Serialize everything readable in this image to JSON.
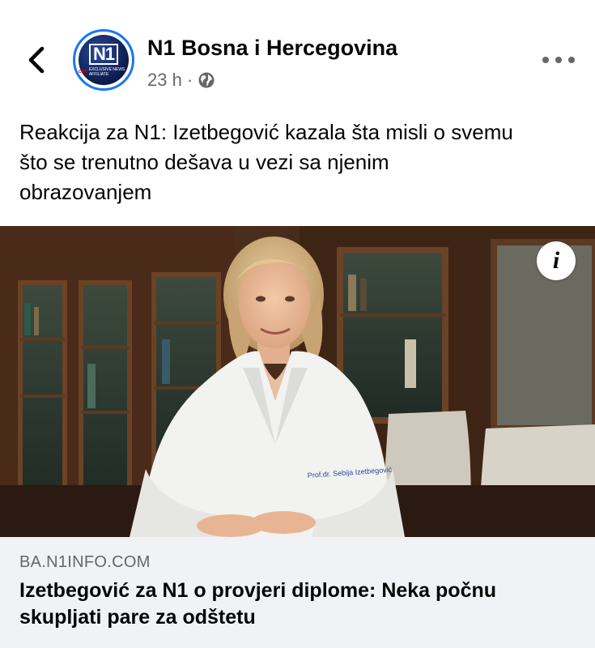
{
  "header": {
    "back_icon": "chevron-left-icon",
    "avatar": {
      "logo_text": "N1",
      "sub_brand": "CNN",
      "sub_text": "EXCLUSIVE NEWS AFFILIATE"
    },
    "page_name": "N1 Bosna i Hercegovina",
    "timestamp": "23 h",
    "separator": "·",
    "privacy_icon": "globe-icon",
    "more_icon": "more-options-icon"
  },
  "post": {
    "text_lines": [
      "Reakcija za N1: Izetbegović kazala šta misli o svemu",
      "što se trenutno dešava u vezi sa njenim",
      "obrazovanjem"
    ]
  },
  "photo": {
    "coat_label": "Prof.dr. Sebija Izetbegović",
    "info_icon": "info-icon",
    "info_symbol": "i"
  },
  "link_card": {
    "domain": "BA.N1INFO.COM",
    "headline_lines": [
      "Izetbegović za N1 o provjeri diplome: Neka počnu",
      "skupljati pare za odštetu"
    ]
  },
  "colors": {
    "brand_blue": "#1877f2",
    "secondary_text": "#65676b",
    "card_background": "#f0f2f5",
    "primary_text": "#050505"
  }
}
